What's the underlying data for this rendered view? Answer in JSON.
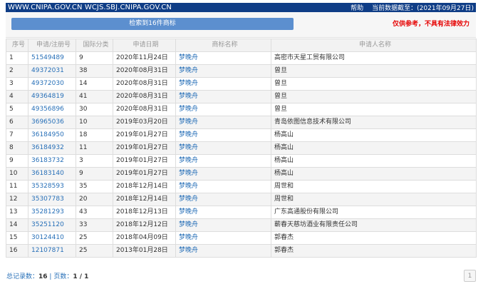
{
  "header": {
    "site": "WWW.CNIPA.GOV.CN WCJS.SBJ.CNIPA.GOV.CN",
    "help": "帮助",
    "data_date": "当前数据截至：(2021年09月27日)"
  },
  "banner": {
    "count_label": "检索到16件商标",
    "disclaimer": "仅供参考，不具有法律效力"
  },
  "table": {
    "headers": [
      "序号",
      "申请/注册号",
      "国际分类",
      "申请日期",
      "商标名称",
      "申请人名称"
    ],
    "rows": [
      [
        "1",
        "51549489",
        "9",
        "2020年11月24日",
        "梦晚舟",
        "高密市天星工贸有限公司"
      ],
      [
        "2",
        "49372031",
        "38",
        "2020年08月31日",
        "梦晚舟",
        "曾旦"
      ],
      [
        "3",
        "49372030",
        "14",
        "2020年08月31日",
        "梦晚舟",
        "曾旦"
      ],
      [
        "4",
        "49364819",
        "41",
        "2020年08月31日",
        "梦晚舟",
        "曾旦"
      ],
      [
        "5",
        "49356896",
        "30",
        "2020年08月31日",
        "梦晚舟",
        "曾旦"
      ],
      [
        "6",
        "36965036",
        "10",
        "2019年03月20日",
        "梦晚舟",
        "青岛依图信息技术有限公司"
      ],
      [
        "7",
        "36184950",
        "18",
        "2019年01月27日",
        "梦晚舟",
        "杨高山"
      ],
      [
        "8",
        "36184932",
        "11",
        "2019年01月27日",
        "梦晚舟",
        "杨高山"
      ],
      [
        "9",
        "36183732",
        "3",
        "2019年01月27日",
        "梦晚舟",
        "杨高山"
      ],
      [
        "10",
        "36183140",
        "9",
        "2019年01月27日",
        "梦晚舟",
        "杨高山"
      ],
      [
        "11",
        "35328593",
        "35",
        "2018年12月14日",
        "梦晚舟",
        "周世和"
      ],
      [
        "12",
        "35307783",
        "20",
        "2018年12月14日",
        "梦晚舟",
        "周世和"
      ],
      [
        "13",
        "35281293",
        "43",
        "2018年12月13日",
        "梦晚舟",
        "广东高通股份有限公司"
      ],
      [
        "14",
        "35251120",
        "33",
        "2018年12月12日",
        "梦晚舟",
        "蕲春天慈坊酒业有限责任公司"
      ],
      [
        "15",
        "30124410",
        "25",
        "2018年04月09日",
        "梦晚舟",
        "郭春杰"
      ],
      [
        "16",
        "12107871",
        "25",
        "2013年01月28日",
        "梦晚舟",
        "郭春杰"
      ]
    ]
  },
  "footer": {
    "total_label": "总记录数：",
    "total": "16",
    "sep": " | ",
    "pages_label": "页数：",
    "pages": "1 / 1"
  },
  "pager": {
    "page": "1"
  }
}
